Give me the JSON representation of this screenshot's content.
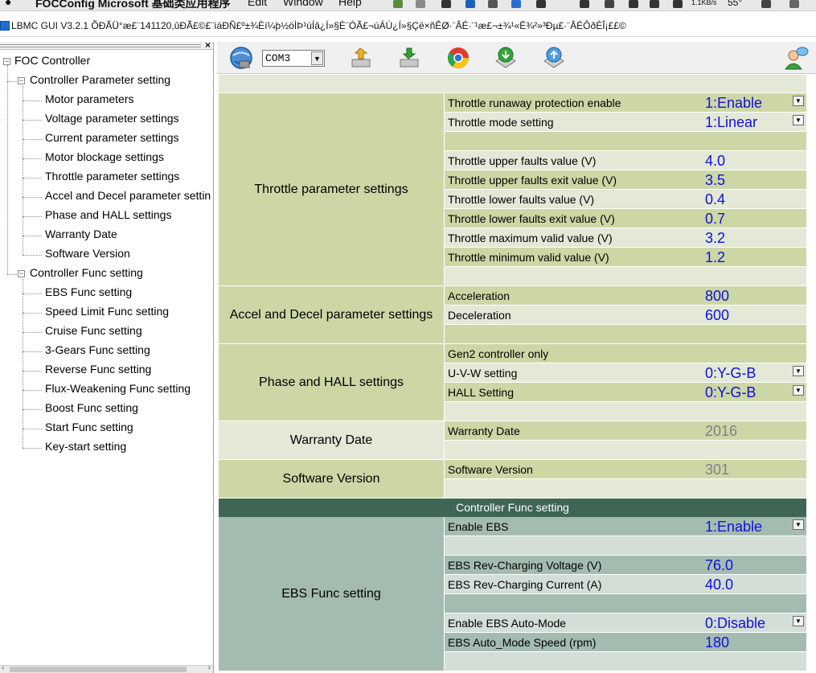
{
  "menubar": {
    "app_name": "FOCConfig Microsoft 基础类应用程序",
    "menus": [
      "Edit",
      "Window",
      "Help"
    ],
    "net_speed": "1.1KB/s",
    "temperature": "55°"
  },
  "window": {
    "title": "LBMC GUI V3.2.1 ÕÐÃÜ°æ£¨141120,ûÐÃ£©£¨ìáÐÑ£º±¾Èí¼þ½öÌÞ¹úÍâ¿Í»§È¨ÓÃ£¬úÁÚ¿Í»§Çë×ñÊØ·¨ÂÉ·¨¹æ£¬±¾¹«Ë¾²»³Ðµ£·¨ÂÉÔðÈÎ¡££©"
  },
  "left_panel": {
    "close_label": "×",
    "root": "FOC Controller",
    "groups": [
      {
        "label": "Controller Parameter setting",
        "items": [
          "Motor parameters",
          "Voltage parameter settings",
          "Current parameter settings",
          "Motor blockage settings",
          "Throttle parameter settings",
          "Accel and Decel parameter settin",
          "Phase and HALL settings",
          "Warranty Date",
          "Software Version"
        ]
      },
      {
        "label": "Controller Func setting",
        "items": [
          "EBS Func setting",
          "Speed Limit Func setting",
          "Cruise Func setting",
          "3-Gears Func setting",
          "Reverse Func setting",
          "Flux-Weakening Func setting",
          "Boost Func setting",
          "Start Func setting",
          "Key-start setting"
        ]
      }
    ]
  },
  "toolbar": {
    "port_value": "COM3",
    "buttons": [
      "connect-icon",
      "read-icon",
      "write-icon",
      "chrome-icon",
      "download-icon",
      "upload-icon",
      "user-icon"
    ]
  },
  "grid": {
    "controller_func_banner": "Controller Func setting",
    "sections": {
      "throttle": {
        "label": "Throttle parameter settings",
        "params": [
          {
            "name": "Throttle runaway protection enable",
            "value": "1:Enable"
          },
          {
            "name": "Throttle mode setting",
            "value": "1:Linear"
          },
          {
            "name": "Throttle upper faults value (V)",
            "value": "4.0"
          },
          {
            "name": "Throttle upper faults exit value (V)",
            "value": "3.5"
          },
          {
            "name": "Throttle lower faults value (V)",
            "value": "0.4"
          },
          {
            "name": "Throttle lower faults exit value (V)",
            "value": "0.7"
          },
          {
            "name": "Throttle maximum valid value (V)",
            "value": "3.2"
          },
          {
            "name": "Throttle minimum valid value (V)",
            "value": "1.2"
          }
        ]
      },
      "accel": {
        "label": "Accel and Decel parameter settings",
        "params": [
          {
            "name": "Acceleration",
            "value": "800"
          },
          {
            "name": "Deceleration",
            "value": "600"
          }
        ]
      },
      "phase": {
        "label": "Phase and HALL settings",
        "params": [
          {
            "name": "Gen2 controller only",
            "value": ""
          },
          {
            "name": "U-V-W setting",
            "value": "0:Y-G-B"
          },
          {
            "name": "HALL Setting",
            "value": "0:Y-G-B"
          }
        ]
      },
      "warranty": {
        "label": "Warranty Date",
        "params": [
          {
            "name": "Warranty Date",
            "value": "2016"
          }
        ]
      },
      "software": {
        "label": "Software Version",
        "params": [
          {
            "name": "Software Version",
            "value": "301"
          }
        ]
      },
      "ebs": {
        "label": "EBS Func setting",
        "params": [
          {
            "name": "Enable EBS",
            "value": "1:Enable"
          },
          {
            "name": "EBS Rev-Charging Voltage (V)",
            "value": "76.0"
          },
          {
            "name": "EBS Rev-Charging Current (A)",
            "value": "40.0"
          },
          {
            "name": "Enable EBS Auto-Mode",
            "value": "0:Disable"
          },
          {
            "name": "EBS Auto_Mode Speed (rpm)",
            "value": "180"
          }
        ]
      }
    }
  },
  "colors": {
    "controller_section": "#cdd7a6",
    "controller_alt_row": "#e3e8d7",
    "func_section": "#a4bcb0",
    "func_alt_row": "#d2ded6",
    "banner": "#3f6655",
    "value_text": "#1010d8",
    "readonly_text": "#808080"
  }
}
